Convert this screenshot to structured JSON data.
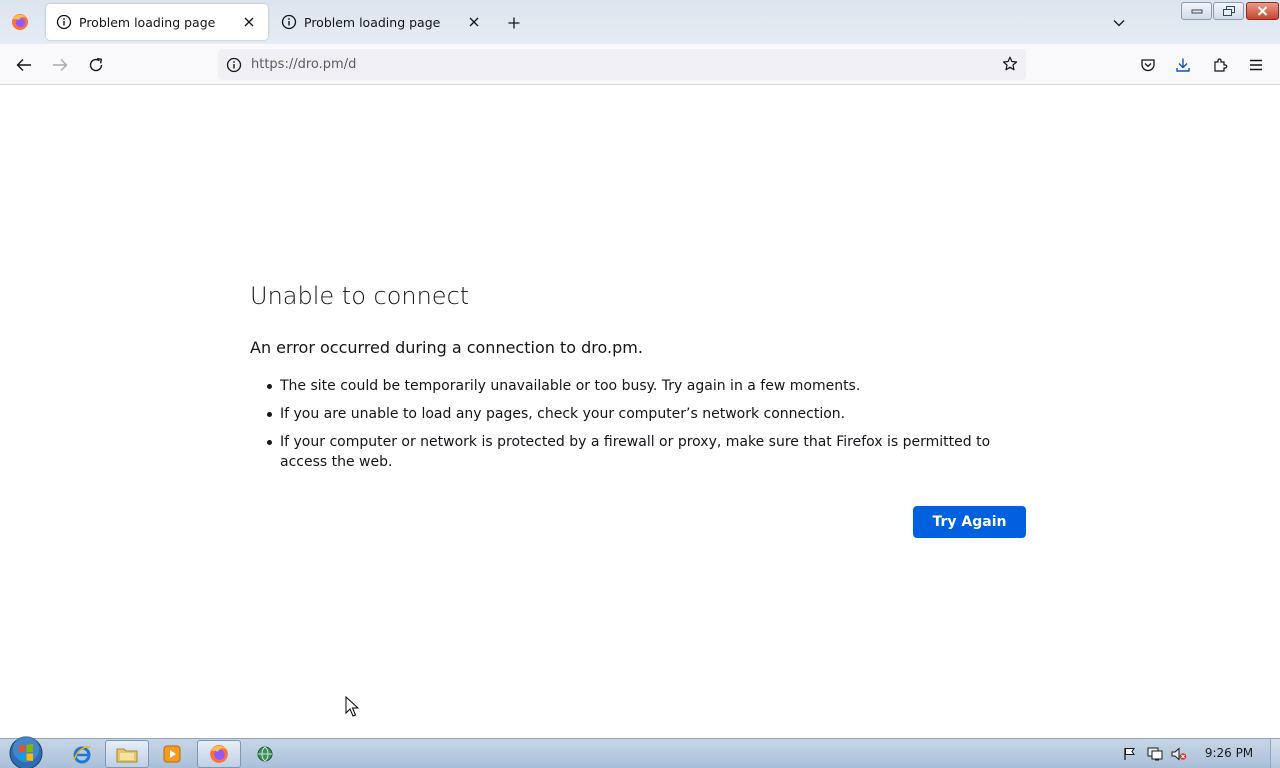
{
  "browser": {
    "tabs": [
      {
        "title": "Problem loading page",
        "active": true
      },
      {
        "title": "Problem loading page",
        "active": false
      }
    ],
    "url": {
      "scheme_host": "https://dro.pm",
      "path": "/d"
    }
  },
  "error_page": {
    "title": "Unable to connect",
    "description": "An error occurred during a connection to dro.pm.",
    "suggestions": [
      "The site could be temporarily unavailable or too busy. Try again in a few moments.",
      "If you are unable to load any pages, check your computer’s network connection.",
      "If your computer or network is protected by a firewall or proxy, make sure that Firefox is permitted to access the web."
    ],
    "try_again_label": "Try Again"
  },
  "taskbar": {
    "clock": "9:26 PM",
    "items": [
      "internet-explorer-icon",
      "file-explorer-icon",
      "media-player-icon",
      "firefox-icon",
      "network-globe-icon"
    ]
  },
  "colors": {
    "accent_button": "#0061e0",
    "urlbar_bg": "#f0f0f4",
    "text": "#15141a"
  }
}
